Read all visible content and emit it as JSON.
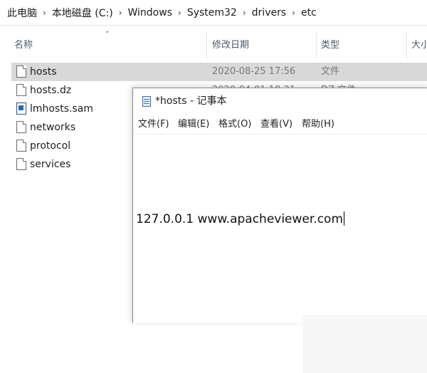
{
  "breadcrumb": [
    "此电脑",
    "本地磁盘 (C:)",
    "Windows",
    "System32",
    "drivers",
    "etc"
  ],
  "breadcrumb_separator": "›",
  "columns": {
    "name": "名称",
    "modified": "修改日期",
    "type": "类型",
    "size": "大小"
  },
  "files": [
    {
      "name": "hosts",
      "modified": "2020-08-25 17:56",
      "type": "文件",
      "icon": "file-icon",
      "selected": true
    },
    {
      "name": "hosts.dz",
      "modified": "2020-04-01 18:21",
      "type": "DZ 文件",
      "icon": "file-icon"
    },
    {
      "name": "lmhosts.sam",
      "modified": "",
      "type": "",
      "icon": "sam-file-icon"
    },
    {
      "name": "networks",
      "modified": "",
      "type": "",
      "icon": "file-icon"
    },
    {
      "name": "protocol",
      "modified": "",
      "type": "",
      "icon": "file-icon"
    },
    {
      "name": "services",
      "modified": "",
      "type": "",
      "icon": "file-icon"
    }
  ],
  "notepad": {
    "title": "*hosts - 记事本",
    "menu": [
      "文件(F)",
      "编辑(E)",
      "格式(O)",
      "查看(V)",
      "帮助(H)"
    ],
    "content": "127.0.0.1 www.apacheviewer.com"
  },
  "colors": {
    "selected_row": "#d9d9d9",
    "header_text": "#4a5a6a"
  }
}
